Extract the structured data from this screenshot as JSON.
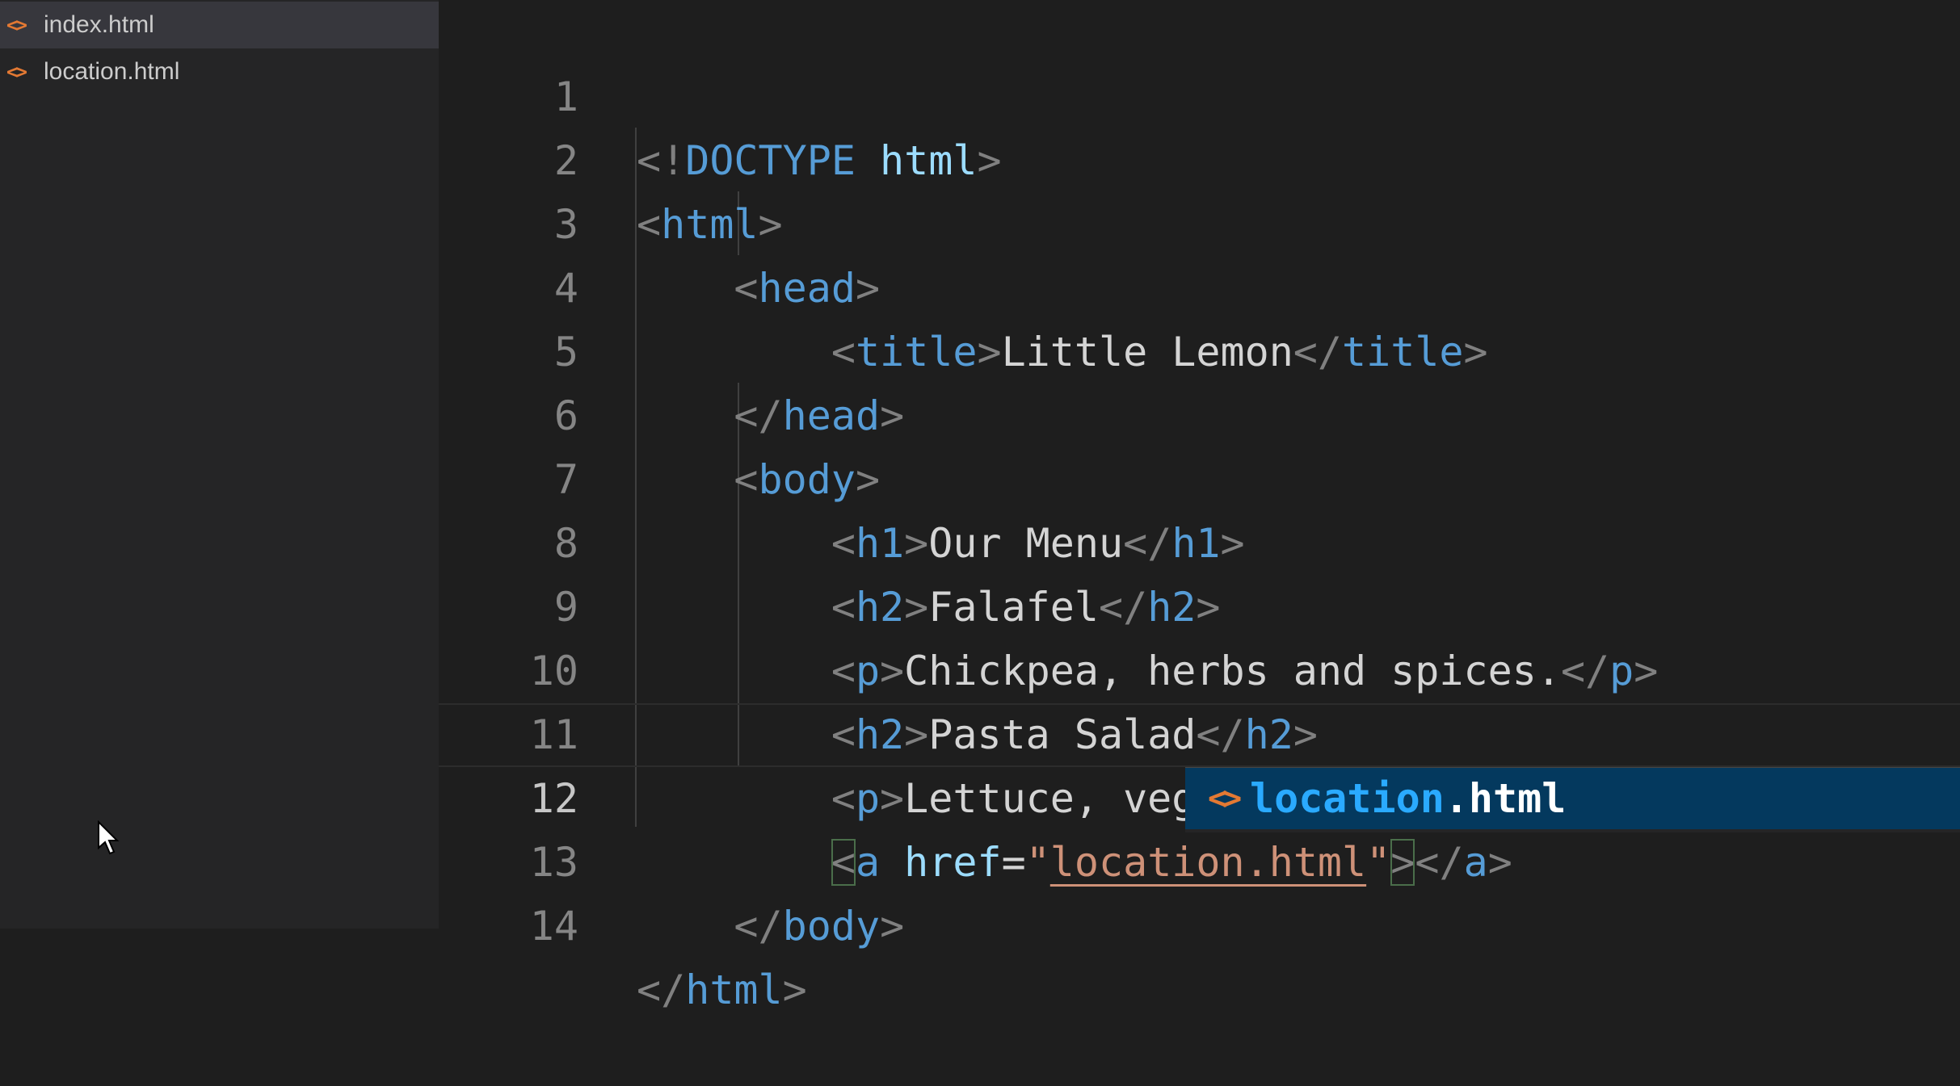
{
  "explorer": {
    "files": [
      {
        "icon": "<>",
        "name": "index.html",
        "active": true
      },
      {
        "icon": "<>",
        "name": "location.html",
        "active": false
      }
    ]
  },
  "editor": {
    "line_numbers": [
      "1",
      "2",
      "3",
      "4",
      "5",
      "6",
      "7",
      "8",
      "9",
      "10",
      "11",
      "12",
      "13",
      "14"
    ],
    "current_line": 12,
    "lines": {
      "l1": {
        "open": "<!",
        "doctype": "DOCTYPE",
        "html": "html",
        "close": ">"
      },
      "l2": {
        "open": "<",
        "tag": "html",
        "close": ">"
      },
      "l3": {
        "open": "<",
        "tag": "head",
        "close": ">"
      },
      "l4": {
        "open": "<",
        "tag": "title",
        "gt": ">",
        "text": "Little Lemon",
        "lt": "</",
        "ctag": "title",
        "close": ">"
      },
      "l5": {
        "open": "</",
        "tag": "head",
        "close": ">"
      },
      "l6": {
        "open": "<",
        "tag": "body",
        "close": ">"
      },
      "l7": {
        "open": "<",
        "tag": "h1",
        "gt": ">",
        "text": "Our Menu",
        "lt": "</",
        "ctag": "h1",
        "close": ">"
      },
      "l8": {
        "open": "<",
        "tag": "h2",
        "gt": ">",
        "text": "Falafel",
        "lt": "</",
        "ctag": "h2",
        "close": ">"
      },
      "l9": {
        "open": "<",
        "tag": "p",
        "gt": ">",
        "text": "Chickpea, herbs and spices.",
        "lt": "</",
        "ctag": "p",
        "close": ">"
      },
      "l10": {
        "open": "<",
        "tag": "h2",
        "gt": ">",
        "text": "Pasta Salad",
        "lt": "</",
        "ctag": "h2",
        "close": ">"
      },
      "l11": {
        "open": "<",
        "tag": "p",
        "gt": ">",
        "text": "Lettuce, vegetables and mozzarella.",
        "lt": "</",
        "ctag": "p",
        "close": ">"
      },
      "l12": {
        "open": "<",
        "tag": "a",
        "attr": "href",
        "eq": "=",
        "q1": "\"",
        "value": "location.html",
        "q2": "\"",
        "gt": ">",
        "lt": "</",
        "ctag": "a",
        "close": ">"
      },
      "l13": {
        "open": "</",
        "tag": "body",
        "close": ">"
      },
      "l14": {
        "open": "</",
        "tag": "html",
        "close": ">"
      }
    }
  },
  "suggestion": {
    "icon": "<>",
    "match": "location",
    "rest": ".html"
  },
  "colors": {
    "tag": "#569cd6",
    "punctuation": "#808080",
    "attribute": "#9cdcfe",
    "string": "#ce9178",
    "text": "#d4d4d4",
    "file_icon": "#e37933",
    "suggest_selected": "#04395e"
  }
}
